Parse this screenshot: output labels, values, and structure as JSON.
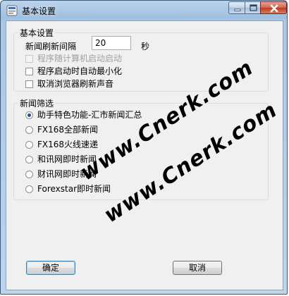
{
  "window": {
    "title": "基本设置"
  },
  "basic": {
    "group_title": "基本设置",
    "interval_label": "新闻刷新间隔",
    "interval_value": "20",
    "interval_unit": "秒",
    "checkboxes": [
      {
        "label": "程序随计算机启动启动",
        "checked": false,
        "disabled": true
      },
      {
        "label": "程序启动时自动最小化",
        "checked": false,
        "disabled": false
      },
      {
        "label": "取消浏览器刷新声音",
        "checked": false,
        "disabled": false
      }
    ]
  },
  "news": {
    "group_title": "新闻筛选",
    "options": [
      {
        "label": "助手特色功能-汇市新闻汇总",
        "selected": true
      },
      {
        "label": "FX168全部新闻",
        "selected": false
      },
      {
        "label": "FX168火线速递",
        "selected": false
      },
      {
        "label": "和讯网即时新闻",
        "selected": false
      },
      {
        "label": "财讯网即时新闻",
        "selected": false
      },
      {
        "label": "Forexstar即时新闻",
        "selected": false
      }
    ]
  },
  "buttons": {
    "ok": "确定",
    "cancel": "取消"
  },
  "watermarks": [
    "www.Cnerk.com",
    "www.Cnerk.com"
  ],
  "icons": {
    "app": "app-icon",
    "minimize": "minimize-icon",
    "maximize": "maximize-icon",
    "close": "close-icon"
  },
  "colors": {
    "titlebar": "#a9c7e6",
    "close_button": "#c0391f",
    "radio_dot": "#1f4f94",
    "dialog_background": "#f0f0f0"
  }
}
